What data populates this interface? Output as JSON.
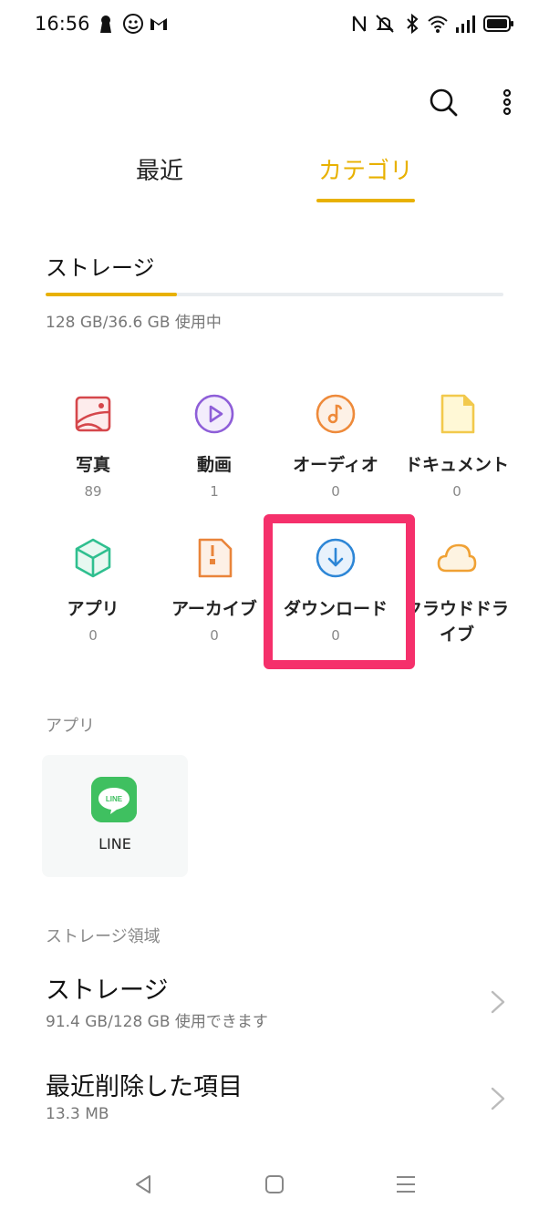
{
  "status_bar": {
    "time": "16:56",
    "left_icons": [
      "keyhole-icon",
      "face-icon",
      "gmail-icon"
    ],
    "right_icons": [
      "nfc-icon",
      "mute-icon",
      "bluetooth-icon",
      "wifi-icon",
      "signal-icon",
      "battery-icon"
    ]
  },
  "toolbar": {
    "icons": [
      "search-icon",
      "more-vert-icon"
    ]
  },
  "tabs": [
    {
      "label": "最近",
      "active": false
    },
    {
      "label": "カテゴリ",
      "active": true
    }
  ],
  "storage": {
    "title": "ストレージ",
    "usage_text": "128 GB/36.6 GB 使用中",
    "used_fraction": 0.286,
    "accent": "#e8b100"
  },
  "categories": [
    {
      "label": "写真",
      "count": "89",
      "icon": "photo-icon",
      "color": "#d5474b"
    },
    {
      "label": "動画",
      "count": "1",
      "icon": "video-icon",
      "color": "#8e5ed8"
    },
    {
      "label": "オーディオ",
      "count": "0",
      "icon": "audio-icon",
      "color": "#ee8a3a"
    },
    {
      "label": "ドキュメント",
      "count": "0",
      "icon": "document-icon",
      "color": "#f2c94c"
    },
    {
      "label": "アプリ",
      "count": "0",
      "icon": "app-cube-icon",
      "color": "#2fbf8f"
    },
    {
      "label": "アーカイブ",
      "count": "0",
      "icon": "archive-icon",
      "color": "#e9843a"
    },
    {
      "label": "ダウンロード",
      "count": "0",
      "icon": "download-icon",
      "color": "#2d86d6"
    },
    {
      "label": "クラウドドライブ",
      "count": "",
      "icon": "cloud-icon",
      "color": "#f0a134"
    }
  ],
  "highlight_color": "#f5306b",
  "apps": {
    "title": "アプリ",
    "items": [
      {
        "label": "LINE",
        "icon": "line-logo-icon",
        "color": "#3fc060"
      }
    ]
  },
  "storage_region": {
    "title": "ストレージ領域",
    "rows": [
      {
        "title": "ストレージ",
        "sub": "91.4 GB/128 GB 使用できます"
      },
      {
        "title": "最近削除した項目",
        "sub": "13.3 MB"
      }
    ]
  },
  "nav_bar": {
    "icons": [
      "back-icon",
      "home-icon",
      "menu-icon"
    ]
  }
}
